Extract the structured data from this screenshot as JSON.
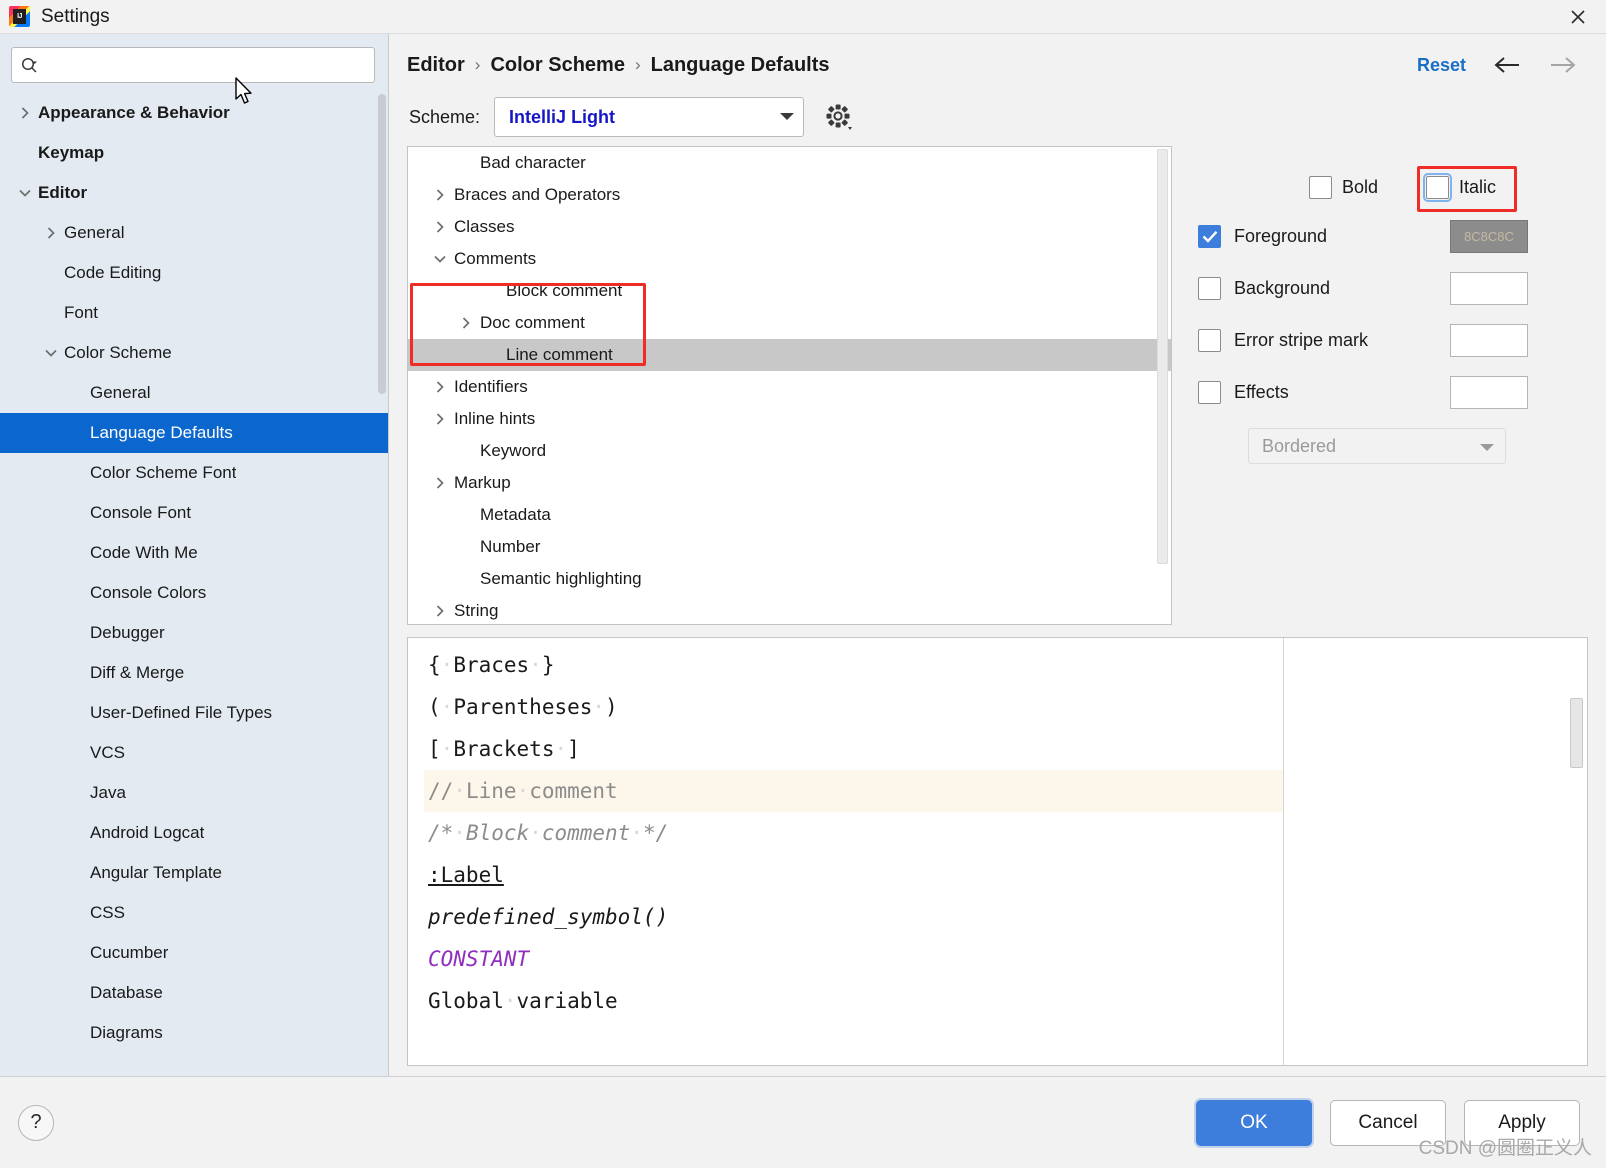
{
  "window": {
    "title": "Settings",
    "app_icon": "intellij-idea-icon",
    "close_icon": "close-icon"
  },
  "search": {
    "placeholder": "",
    "value": "",
    "icon": "search-icon"
  },
  "sidebar": {
    "items": [
      {
        "label": "Appearance & Behavior",
        "indent": 0,
        "twist": "collapsed",
        "bold": true,
        "selected": false
      },
      {
        "label": "Keymap",
        "indent": 0,
        "twist": "none",
        "bold": true,
        "selected": false
      },
      {
        "label": "Editor",
        "indent": 0,
        "twist": "expanded",
        "bold": true,
        "selected": false
      },
      {
        "label": "General",
        "indent": 1,
        "twist": "collapsed",
        "bold": false,
        "selected": false
      },
      {
        "label": "Code Editing",
        "indent": 1,
        "twist": "none",
        "bold": false,
        "selected": false
      },
      {
        "label": "Font",
        "indent": 1,
        "twist": "none",
        "bold": false,
        "selected": false
      },
      {
        "label": "Color Scheme",
        "indent": 1,
        "twist": "expanded",
        "bold": false,
        "selected": false
      },
      {
        "label": "General",
        "indent": 2,
        "twist": "none",
        "bold": false,
        "selected": false
      },
      {
        "label": "Language Defaults",
        "indent": 2,
        "twist": "none",
        "bold": false,
        "selected": true
      },
      {
        "label": "Color Scheme Font",
        "indent": 2,
        "twist": "none",
        "bold": false,
        "selected": false
      },
      {
        "label": "Console Font",
        "indent": 2,
        "twist": "none",
        "bold": false,
        "selected": false
      },
      {
        "label": "Code With Me",
        "indent": 2,
        "twist": "none",
        "bold": false,
        "selected": false
      },
      {
        "label": "Console Colors",
        "indent": 2,
        "twist": "none",
        "bold": false,
        "selected": false
      },
      {
        "label": "Debugger",
        "indent": 2,
        "twist": "none",
        "bold": false,
        "selected": false
      },
      {
        "label": "Diff & Merge",
        "indent": 2,
        "twist": "none",
        "bold": false,
        "selected": false
      },
      {
        "label": "User-Defined File Types",
        "indent": 2,
        "twist": "none",
        "bold": false,
        "selected": false
      },
      {
        "label": "VCS",
        "indent": 2,
        "twist": "none",
        "bold": false,
        "selected": false
      },
      {
        "label": "Java",
        "indent": 2,
        "twist": "none",
        "bold": false,
        "selected": false
      },
      {
        "label": "Android Logcat",
        "indent": 2,
        "twist": "none",
        "bold": false,
        "selected": false
      },
      {
        "label": "Angular Template",
        "indent": 2,
        "twist": "none",
        "bold": false,
        "selected": false
      },
      {
        "label": "CSS",
        "indent": 2,
        "twist": "none",
        "bold": false,
        "selected": false
      },
      {
        "label": "Cucumber",
        "indent": 2,
        "twist": "none",
        "bold": false,
        "selected": false
      },
      {
        "label": "Database",
        "indent": 2,
        "twist": "none",
        "bold": false,
        "selected": false
      },
      {
        "label": "Diagrams",
        "indent": 2,
        "twist": "none",
        "bold": false,
        "selected": false
      }
    ]
  },
  "header": {
    "breadcrumb": [
      "Editor",
      "Color Scheme",
      "Language Defaults"
    ],
    "separator": "›",
    "reset_label": "Reset",
    "back_icon": "arrow-left-icon",
    "forward_icon": "arrow-right-icon"
  },
  "scheme": {
    "label": "Scheme:",
    "value": "IntelliJ Light",
    "dropdown_icon": "chevron-down-icon",
    "gear_icon": "gear-icon"
  },
  "attribute_tree": {
    "items": [
      {
        "label": "Bad character",
        "indent": 1,
        "twist": "none",
        "selected": false
      },
      {
        "label": "Braces and Operators",
        "indent": 0,
        "twist": "collapsed",
        "selected": false
      },
      {
        "label": "Classes",
        "indent": 0,
        "twist": "collapsed",
        "selected": false
      },
      {
        "label": "Comments",
        "indent": 0,
        "twist": "expanded",
        "selected": false
      },
      {
        "label": "Block comment",
        "indent": 2,
        "twist": "none",
        "selected": false
      },
      {
        "label": "Doc comment",
        "indent": 1,
        "twist": "collapsed",
        "selected": false
      },
      {
        "label": "Line comment",
        "indent": 2,
        "twist": "none",
        "selected": true
      },
      {
        "label": "Identifiers",
        "indent": 0,
        "twist": "collapsed",
        "selected": false
      },
      {
        "label": "Inline hints",
        "indent": 0,
        "twist": "collapsed",
        "selected": false
      },
      {
        "label": "Keyword",
        "indent": 1,
        "twist": "none",
        "selected": false
      },
      {
        "label": "Markup",
        "indent": 0,
        "twist": "collapsed",
        "selected": false
      },
      {
        "label": "Metadata",
        "indent": 1,
        "twist": "none",
        "selected": false
      },
      {
        "label": "Number",
        "indent": 1,
        "twist": "none",
        "selected": false
      },
      {
        "label": "Semantic highlighting",
        "indent": 1,
        "twist": "none",
        "selected": false
      },
      {
        "label": "String",
        "indent": 0,
        "twist": "collapsed",
        "selected": false
      }
    ]
  },
  "attributes": {
    "bold": {
      "label": "Bold",
      "checked": false
    },
    "italic": {
      "label": "Italic",
      "checked": false,
      "focused": true
    },
    "rows": [
      {
        "label": "Foreground",
        "checked": true,
        "swatch": "8C8C8C",
        "swatch_filled": true
      },
      {
        "label": "Background",
        "checked": false,
        "swatch": "",
        "swatch_filled": false
      },
      {
        "label": "Error stripe mark",
        "checked": false,
        "swatch": "",
        "swatch_filled": false
      },
      {
        "label": "Effects",
        "checked": false,
        "swatch": "",
        "swatch_filled": false
      }
    ],
    "effects_combo": {
      "value": "Bordered",
      "dropdown_icon": "chevron-down-icon"
    },
    "foreground_color": "#8C8C8C",
    "accent_color": "#3D7DDB",
    "annotation_color": "#EF2C26"
  },
  "preview": {
    "lines": [
      {
        "highlight": false,
        "parts": [
          {
            "t": "{",
            "c": "plain"
          },
          {
            "t": "·",
            "c": "dot"
          },
          {
            "t": "Braces",
            "c": "plain"
          },
          {
            "t": "·",
            "c": "dot"
          },
          {
            "t": "}",
            "c": "plain"
          }
        ]
      },
      {
        "highlight": false,
        "parts": [
          {
            "t": "(",
            "c": "plain"
          },
          {
            "t": "·",
            "c": "dot"
          },
          {
            "t": "Parentheses",
            "c": "plain"
          },
          {
            "t": "·",
            "c": "dot"
          },
          {
            "t": ")",
            "c": "plain"
          }
        ]
      },
      {
        "highlight": false,
        "parts": [
          {
            "t": "[",
            "c": "plain"
          },
          {
            "t": "·",
            "c": "dot"
          },
          {
            "t": "Brackets",
            "c": "plain"
          },
          {
            "t": "·",
            "c": "dot"
          },
          {
            "t": "]",
            "c": "plain"
          }
        ]
      },
      {
        "highlight": true,
        "parts": [
          {
            "t": "//",
            "c": "comment"
          },
          {
            "t": "·",
            "c": "dot"
          },
          {
            "t": "Line",
            "c": "comment"
          },
          {
            "t": "·",
            "c": "dot"
          },
          {
            "t": "comment",
            "c": "comment"
          }
        ]
      },
      {
        "highlight": false,
        "parts": [
          {
            "t": "/*",
            "c": "comment-i"
          },
          {
            "t": "·",
            "c": "dot"
          },
          {
            "t": "Block",
            "c": "comment-i"
          },
          {
            "t": "·",
            "c": "dot"
          },
          {
            "t": "comment",
            "c": "comment-i"
          },
          {
            "t": "·",
            "c": "dot"
          },
          {
            "t": "*/",
            "c": "comment-i"
          }
        ]
      },
      {
        "highlight": false,
        "parts": [
          {
            "t": ":Label",
            "c": "label"
          }
        ]
      },
      {
        "highlight": false,
        "parts": [
          {
            "t": "predefined_symbol()",
            "c": "sym"
          }
        ]
      },
      {
        "highlight": false,
        "parts": [
          {
            "t": "CONSTANT",
            "c": "const"
          }
        ]
      },
      {
        "highlight": false,
        "parts": [
          {
            "t": "Global",
            "c": "plain"
          },
          {
            "t": "·",
            "c": "dot"
          },
          {
            "t": "variable",
            "c": "plain"
          }
        ]
      }
    ]
  },
  "footer": {
    "help_label": "?",
    "ok_label": "OK",
    "cancel_label": "Cancel",
    "apply_label": "Apply"
  },
  "watermark": "CSDN @圆圈正义人"
}
